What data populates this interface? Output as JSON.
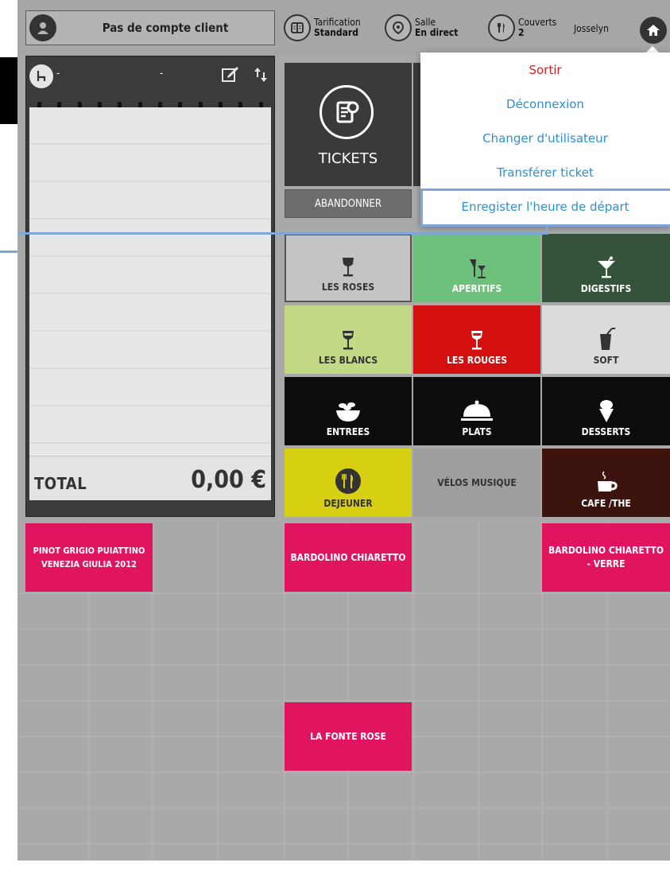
{
  "client": {
    "label": "Pas de compte client"
  },
  "topbar": {
    "tarification_label": "Tarification",
    "tarification_value": "Standard",
    "salle_label": "Salle",
    "salle_value": "En direct",
    "couverts_label": "Couverts",
    "couverts_value": "2",
    "user_name": "Josselyn"
  },
  "ticket": {
    "table_text": "-",
    "table_dash": "-",
    "total_label": "TOTAL",
    "total_value": "0,00 €"
  },
  "actions": {
    "tickets_label": "TICKETS",
    "abandon_label": "ABANDONNER"
  },
  "categories": [
    {
      "label": "LES ROSES"
    },
    {
      "label": "APERITIFS"
    },
    {
      "label": "DIGESTIFS"
    },
    {
      "label": "LES BLANCS"
    },
    {
      "label": "LES ROUGES"
    },
    {
      "label": "SOFT"
    },
    {
      "label": "ENTREES"
    },
    {
      "label": "PLATS"
    },
    {
      "label": "DESSERTS"
    },
    {
      "label": "DEJEUNER"
    },
    {
      "label": "VÉLOS MUSIQUE"
    },
    {
      "label": "CAFE /THE"
    }
  ],
  "products": [
    {
      "label": "PINOT GRIGIO PUIATTINO VENEZIA GIULIA 2012"
    },
    {
      "label": "BARDOLINO CHIARETTO"
    },
    {
      "label": "BARDOLINO CHIARETTO  - VERRE"
    },
    {
      "label": "LA FONTE ROSE"
    }
  ],
  "menu": {
    "items": [
      {
        "label": "Sortir"
      },
      {
        "label": "Déconnexion"
      },
      {
        "label": "Changer d'utilisateur"
      },
      {
        "label": "Transférer ticket"
      },
      {
        "label": "Enregister l'heure de départ"
      }
    ]
  },
  "colors": {
    "pink": "#e0145f",
    "menu_blue": "#2f8fd0",
    "menu_red": "#d61f1f",
    "highlight": "#7ea6d6"
  }
}
